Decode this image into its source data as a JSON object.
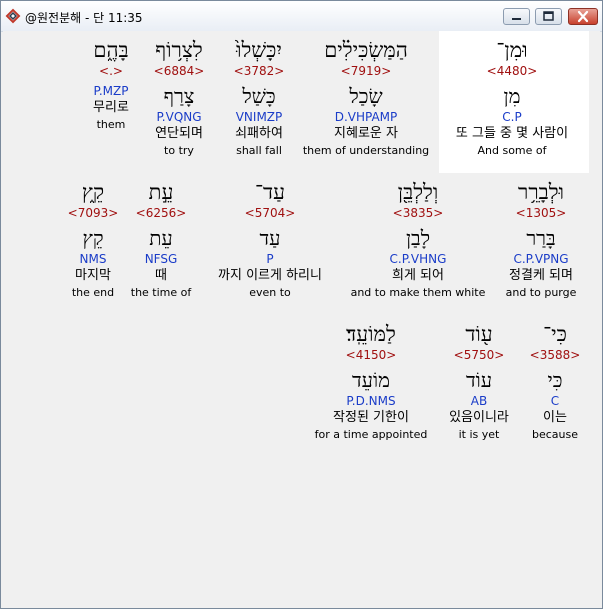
{
  "window": {
    "title": "@원전분해 - 단 11:35"
  },
  "colors": {
    "strong": "#a01010",
    "parse": "#1a3cc8",
    "highlight": "#ffffff"
  },
  "icons": {
    "app": "app-logo-icon",
    "minimize": "minimize-icon",
    "maximize": "maximize-icon",
    "close": "close-icon"
  },
  "rows": [
    {
      "words": [
        {
          "heb1": "בָּהֶ֑ם",
          "strong": "<.>",
          "heb2": "",
          "parse": "P.MZP",
          "kor": "무리로",
          "eng": "them"
        },
        {
          "heb1": "לִצְר֥וֹף",
          "strong": "<6884>",
          "heb2": "צָרַף",
          "parse": "P.VQNG",
          "kor": "연단되며",
          "eng": "to try"
        },
        {
          "heb1": "יִכָּשְׁלוּ֙",
          "strong": "<3782>",
          "heb2": "כָּשַׁל",
          "parse": "VNIMZP",
          "kor": "쇠패하여",
          "eng": "shall fall"
        },
        {
          "heb1": "הַמַּשְׂכִּילִ֗ים",
          "strong": "<7919>",
          "heb2": "שָׂכַל",
          "parse": "D.VHPAMP",
          "kor": "지혜로운 자",
          "eng": "them of understanding"
        },
        {
          "heb1": "וּמִן־",
          "strong": "<4480>",
          "heb2": "מִן",
          "parse": "C.P",
          "kor": "또 그들 중 몇 사람이",
          "eng": "And some of"
        }
      ]
    },
    {
      "words": [
        {
          "heb1": "קֵ֑ץ",
          "strong": "<7093>",
          "heb2": "קֵץ",
          "parse": "NMS",
          "kor": "마지막",
          "eng": "the end"
        },
        {
          "heb1": "עֵ֣ת",
          "strong": "<6256>",
          "heb2": "עֵת",
          "parse": "NFSG",
          "kor": "때",
          "eng": "the time of"
        },
        {
          "heb1": "עַד־",
          "strong": "<5704>",
          "heb2": "עַד",
          "parse": "P",
          "kor": "까지 이르게 하리니",
          "eng": "even to"
        },
        {
          "heb1": "וְלַלְבֵּ֖ן",
          "strong": "<3835>",
          "heb2": "לָבַן",
          "parse": "C.P.VHNG",
          "kor": "희게 되어",
          "eng": "and to make them white"
        },
        {
          "heb1": "וּלְבָרֵ֥ר",
          "strong": "<1305>",
          "heb2": "בָּרַר",
          "parse": "C.P.VPNG",
          "kor": "정결케 되며",
          "eng": "and to purge"
        }
      ]
    },
    {
      "words": [
        {
          "heb1": "לַמּוֹעֵֽד׃",
          "strong": "<4150>",
          "heb2": "מוֹעֵד",
          "parse": "P.D.NMS",
          "kor": "작정된 기한이",
          "eng": "for a time appointed"
        },
        {
          "heb1": "ע֖וֹד",
          "strong": "<5750>",
          "heb2": "עוֹד",
          "parse": "AB",
          "kor": "있음이니라",
          "eng": "it is yet"
        },
        {
          "heb1": "כִּי־",
          "strong": "<3588>",
          "heb2": "כִּי",
          "parse": "C",
          "kor": "이는",
          "eng": "because"
        }
      ]
    }
  ]
}
